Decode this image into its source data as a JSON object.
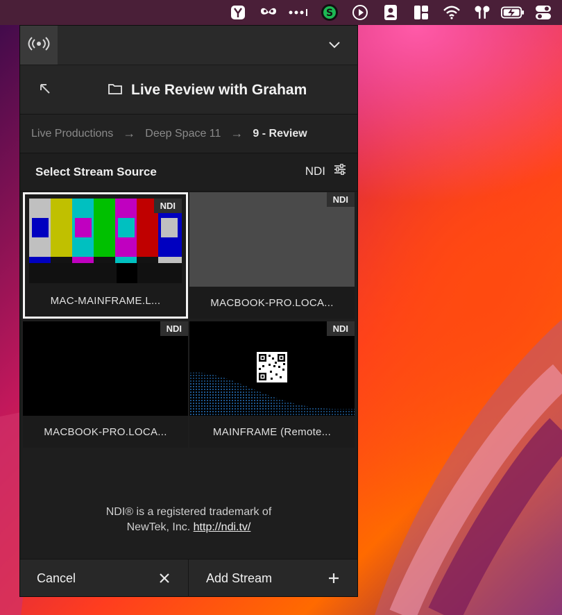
{
  "menubar": {
    "icons": [
      "shield-badge-icon",
      "butterfly-icon",
      "more-dots-icon",
      "green-s-icon",
      "play-circle-icon",
      "person-badge-icon",
      "layout-icon",
      "wifi-icon",
      "airpods-icon",
      "battery-charging-icon",
      "control-center-icon"
    ]
  },
  "panel": {
    "tab_icon": "broadcast-icon",
    "collapse_icon": "chevron-down-icon",
    "header": {
      "back_icon": "arrow-up-left-icon",
      "folder_icon": "folder-icon",
      "title": "Live Review with Graham"
    },
    "breadcrumb": {
      "items": [
        "Live Productions",
        "Deep Space 11",
        "9 - Review"
      ],
      "separator": "→"
    },
    "section": {
      "title": "Select Stream Source",
      "source_type": "NDI",
      "filter_icon": "sliders-icon"
    },
    "sources": [
      {
        "label": "MAC-MAINFRAME.L...",
        "badge": "NDI",
        "selected": true,
        "preview": "color-bars"
      },
      {
        "label": "MACBOOK-PRO.LOCA...",
        "badge": "NDI",
        "selected": false,
        "preview": "gray"
      },
      {
        "label": "MACBOOK-PRO.LOCA...",
        "badge": "NDI",
        "selected": false,
        "preview": "black"
      },
      {
        "label": "MAINFRAME (Remote...",
        "badge": "NDI",
        "selected": false,
        "preview": "qr-wave"
      }
    ],
    "notice": {
      "line1": "NDI® is a registered trademark of",
      "line2_prefix": "NewTek, Inc.",
      "link": "http://ndi.tv/"
    },
    "actions": {
      "cancel_label": "Cancel",
      "add_label": "Add Stream"
    }
  },
  "colors": {
    "panel_bg": "#1e1e1e",
    "selected_border": "#f4f4f4",
    "accent_green": "#1db954"
  }
}
